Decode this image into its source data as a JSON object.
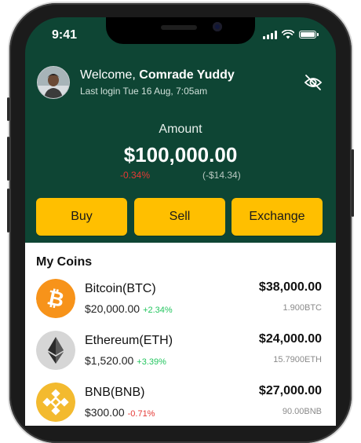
{
  "status": {
    "time": "9:41"
  },
  "header": {
    "welcome_prefix": "Welcome, ",
    "user_name": "Comrade Yuddy",
    "last_login": "Last login Tue 16 Aug, 7:05am"
  },
  "balance": {
    "label": "Amount",
    "value": "$100,000.00",
    "change_percent": "-0.34%",
    "change_amount": "(-$14.34)"
  },
  "actions": {
    "buy": "Buy",
    "sell": "Sell",
    "exchange": "Exchange"
  },
  "coins": {
    "title": "My Coins",
    "items": [
      {
        "name": "Bitcoin(BTC)",
        "price": "$20,000.00",
        "change": "+2.34%",
        "value": "$38,000.00",
        "quantity": "1.900BTC",
        "icon": "bitcoin-icon"
      },
      {
        "name": "Ethereum(ETH)",
        "price": "$1,520.00",
        "change": "+3.39%",
        "value": "$24,000.00",
        "quantity": "15.7900ETH",
        "icon": "ethereum-icon"
      },
      {
        "name": "BNB(BNB)",
        "price": "$300.00",
        "change": "-0.71%",
        "value": "$27,000.00",
        "quantity": "90.00BNB",
        "icon": "bnb-icon"
      }
    ]
  },
  "colors": {
    "header_bg": "#0e4534",
    "accent": "#ffbf00",
    "positive": "#22c55e",
    "negative": "#e53935"
  }
}
